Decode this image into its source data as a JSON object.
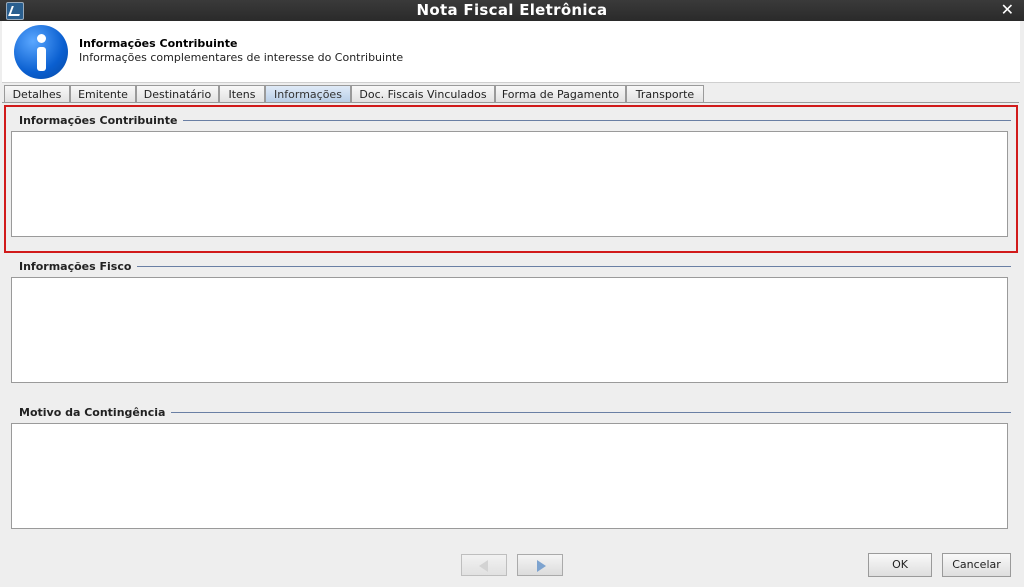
{
  "window": {
    "title": "Nota Fiscal Eletrônica",
    "close_glyph": "✕"
  },
  "header": {
    "title": "Informações  Contribuinte",
    "subtitle": "Informações complementares de interesse do Contribuinte",
    "icon": "info-icon"
  },
  "tabs": [
    {
      "label": "Detalhes",
      "active": false
    },
    {
      "label": "Emitente",
      "active": false
    },
    {
      "label": "Destinatário",
      "active": false
    },
    {
      "label": "Itens",
      "active": false
    },
    {
      "label": "Informações",
      "active": true
    },
    {
      "label": "Doc. Fiscais Vinculados",
      "active": false
    },
    {
      "label": "Forma de Pagamento",
      "active": false
    },
    {
      "label": "Transporte",
      "active": false
    }
  ],
  "sections": [
    {
      "label": "Informações  Contribuinte",
      "value": ""
    },
    {
      "label": "Informações  Fisco",
      "value": ""
    },
    {
      "label": "Motivo da Contingência",
      "value": ""
    }
  ],
  "buttons": {
    "ok": "OK",
    "cancel": "Cancelar"
  },
  "colors": {
    "highlight": "#d11a1a",
    "titlebar": "#2e2e2e",
    "active_tab": "#c6d8ee"
  }
}
